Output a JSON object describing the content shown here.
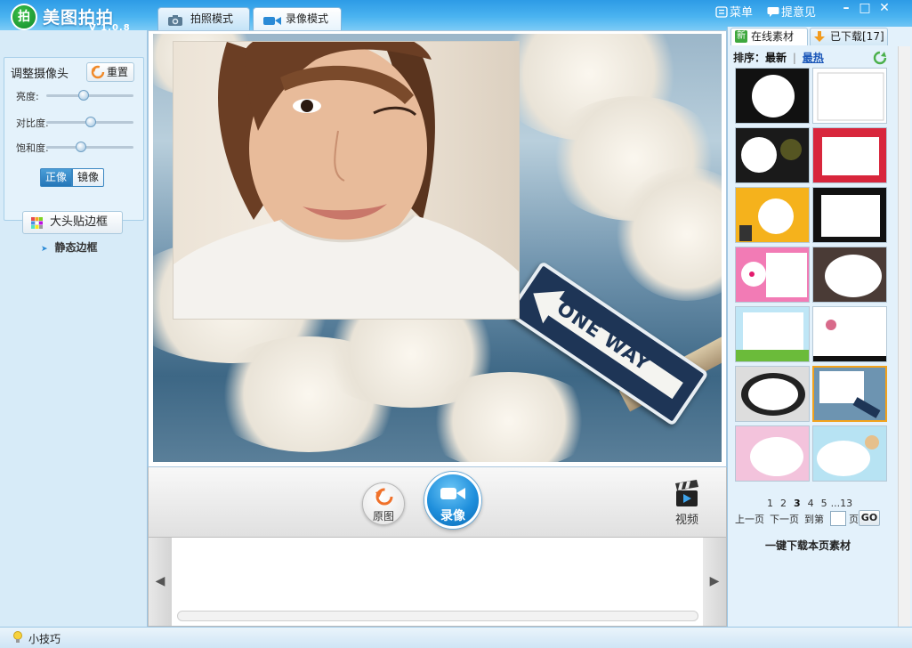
{
  "app": {
    "name": "美图拍拍",
    "version": "V 1.0.8",
    "logo_char": "拍"
  },
  "tabs": [
    {
      "label": "拍照模式",
      "icon": "camera-icon"
    },
    {
      "label": "录像模式",
      "icon": "video-camera-icon"
    }
  ],
  "active_tab": "录像模式",
  "toolbar": {
    "menu_label": "菜单",
    "feedback_label": "提意见",
    "minimize": "–",
    "maximize": "□",
    "close": "✕"
  },
  "camera": {
    "title": "调整摄像头",
    "reset_label": "重置",
    "sliders": [
      {
        "label": "亮度:",
        "value": 0.43
      },
      {
        "label": "对比度:",
        "value": 0.51
      },
      {
        "label": "饱和度:",
        "value": 0.4
      }
    ],
    "mirror_options": [
      "正像",
      "镜像"
    ],
    "mirror_selected": "正像"
  },
  "frames": {
    "button_label": "大头贴边框",
    "sub_item": "静态边框"
  },
  "preview": {
    "sign_text": "ONE WAY"
  },
  "bottom": {
    "original_label": "原图",
    "record_label": "录像",
    "video_label": "视频",
    "prev_arrow": "◀",
    "next_arrow": "▶"
  },
  "materials": {
    "online_tab": "在线素材",
    "online_badge": "新",
    "downloaded_tab": "已下载[17]",
    "sort_label": "排序：",
    "sort_newest": "最新",
    "sort_separator": "|",
    "sort_hottest": "最热",
    "thumbnails": [
      {
        "name": "skull-round-frame"
      },
      {
        "name": "white-corner-frame"
      },
      {
        "name": "dark-rose-frame"
      },
      {
        "name": "red-pattern-frame"
      },
      {
        "name": "sunburst-frame"
      },
      {
        "name": "black-lace-frame"
      },
      {
        "name": "hello-kitty-frame"
      },
      {
        "name": "cloud-shape-frame"
      },
      {
        "name": "flower-meadow-frame"
      },
      {
        "name": "plum-blossom-frame"
      },
      {
        "name": "black-ornament-oval-frame"
      },
      {
        "name": "sky-scene-frame"
      },
      {
        "name": "pink-swirl-frame"
      },
      {
        "name": "beach-frame"
      }
    ],
    "selected_index": 11,
    "pages": [
      "1",
      "2",
      "3",
      "4",
      "5",
      "...",
      "13"
    ],
    "current_page": "3",
    "prev_page": "上一页",
    "next_page": "下一页",
    "goto_label": "到第",
    "page_unit": "页",
    "go_label": "GO",
    "download_all": "一键下载本页素材"
  },
  "status": {
    "tips_label": "小技巧"
  },
  "colors": {
    "accent": "#2a8ad6",
    "selected_thumb": "#f2a21c",
    "record_button": "#1f8fdc",
    "sign": "#1e3556"
  }
}
